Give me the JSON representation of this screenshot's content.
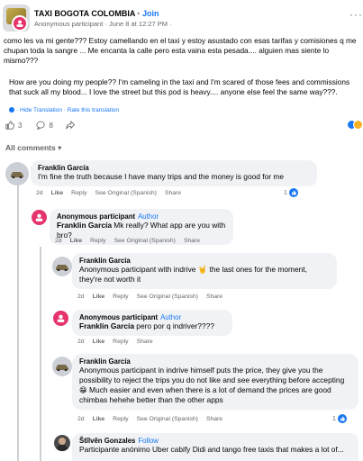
{
  "post": {
    "group_name": "TAXI BOGOTA COLOMBIA",
    "separator": " · ",
    "join_label": "Join",
    "subtitle": "Anonymous participant · June 8 at 12:27 PM ·",
    "body": "como les va mi gente??? Estoy camellando en el taxi y estoy asustado con esas tarifas y comisiones q me chupan toda la sangre ... Me encanta la calle pero esta vaina esta pesada.... alguien mas siente lo mismo???",
    "translation": "How are you doing my people?? I'm cameling in the taxi and I'm scared of those fees and commissions that suck all my blood... I love the street but this pod is heavy.... anyone else feel the same way???.",
    "hide_translation": "· Hide Translation · Rate this translation",
    "like_count": "3",
    "comment_count": "8",
    "all_comments_label": "All comments",
    "more_label": "···"
  },
  "colors": {
    "accent": "#1877f2",
    "anon": "#e4346b",
    "bubble": "#f0f2f5",
    "muted": "#65676b"
  },
  "comments": [
    {
      "author": "Franklin García",
      "author_tag": "",
      "mention": "",
      "text": "I'm fine the truth because I have many trips and the money is good for me",
      "time": "2d",
      "like": "Like",
      "reply": "Reply",
      "see_original": "See Original (Spanish)",
      "share": "Share",
      "reaction_count": "1"
    },
    {
      "author": "Anonymous participant",
      "author_tag": "Author",
      "mention": "Franklin García",
      "text": " Mk really? What app are you with bro?",
      "time": "2d",
      "like": "Like",
      "reply": "Reply",
      "see_original": "See Original (Spanish)",
      "share": "Share"
    },
    {
      "author": "Franklin García",
      "author_tag": "",
      "mention": "",
      "text": "Anonymous participant with indrive 🤘 the last ones for the moment, they're not worth it",
      "time": "2d",
      "like": "Like",
      "reply": "Reply",
      "see_original": "See Original (Spanish)",
      "share": "Share"
    },
    {
      "author": "Anonymous participant",
      "author_tag": "Author",
      "mention": "Franklin García",
      "text": " pero por q indriver????",
      "time": "2d",
      "like": "Like",
      "reply": "Reply",
      "see_original": "",
      "share": "Share"
    },
    {
      "author": "Franklin García",
      "author_tag": "",
      "mention": "",
      "text": "Anonymous participant in indrive himself puts the price, they give you the possibility to reject the trips you do not like and see everything before accepting 😁 Much easier and even when there is a lot of demand the prices are good chimbas hehehe better than the other apps",
      "time": "2d",
      "like": "Like",
      "reply": "Reply",
      "see_original": "See Original (Spanish)",
      "share": "Share",
      "reaction_count": "1"
    },
    {
      "author": "Štĭlvěn Gonzales",
      "author_tag": "Follow",
      "mention": "",
      "text": "Participante anónimo Uber cabify Didi and tango free taxis that makes a lot of..."
    }
  ]
}
